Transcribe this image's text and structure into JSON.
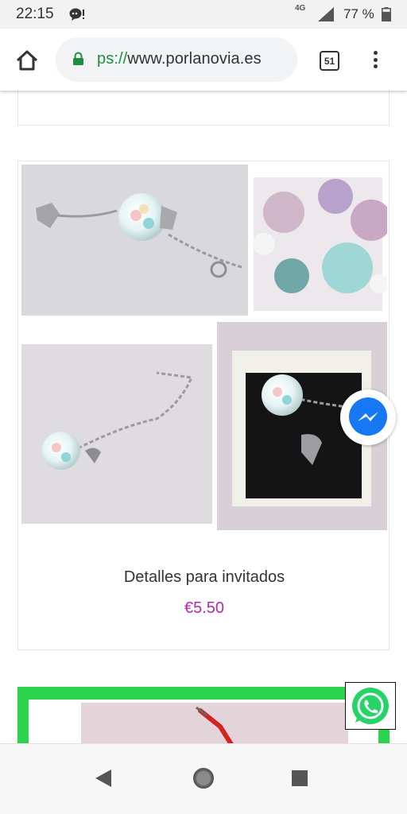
{
  "status_bar": {
    "time": "22:15",
    "network": "4G",
    "battery_percent": "77 %",
    "battery_level": 0.77,
    "icons": [
      "notification-icon",
      "signal-icon",
      "battery-icon"
    ]
  },
  "browser": {
    "url_scheme": "ps://",
    "url_host": "www.porlanovia.es",
    "tab_count": "51",
    "icons": [
      "home-icon",
      "lock-icon",
      "tabs-icon",
      "overflow-menu-icon"
    ]
  },
  "product": {
    "name": "Detalles para invitados",
    "price": "€5.50",
    "price_color": "#b02bb0"
  },
  "floating": {
    "messenger_color": "#1877f2",
    "whatsapp_color": "#25d366"
  },
  "next_card": {
    "border_color": "#2bd44a"
  },
  "navigation": {
    "icons": [
      "back-icon",
      "home-circle-icon",
      "recents-icon"
    ]
  }
}
